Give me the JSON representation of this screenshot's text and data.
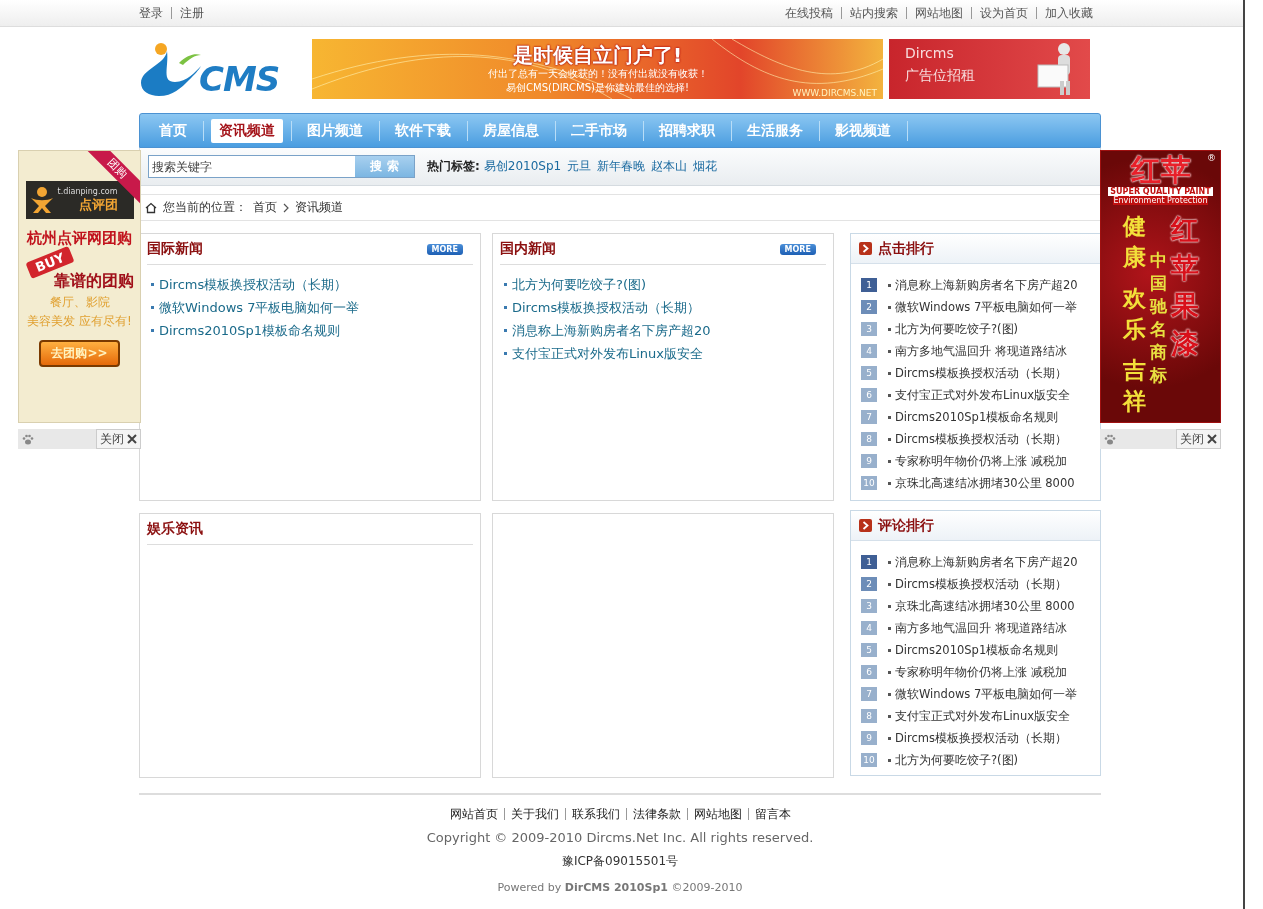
{
  "top_bar": {
    "left_links": [
      "登录",
      "注册"
    ],
    "right_links": [
      "在线投稿",
      "站内搜索",
      "网站地图",
      "设为首页",
      "加入收藏"
    ]
  },
  "header": {
    "logo": "CMS",
    "banner": {
      "title": "是时候自立门户了!",
      "lines": [
        "付出了总有一天会收获的！没有付出就没有收获！",
        "易创CMS(DIRCMS)是你建站最佳的选择!"
      ],
      "url": "WWW.DIRCMS.NET"
    },
    "side_ad": {
      "brand": "Dircms",
      "text": "广告位招租"
    }
  },
  "nav": [
    {
      "label": "首页",
      "selected": false
    },
    {
      "label": "资讯频道",
      "selected": true
    },
    {
      "label": "图片频道",
      "selected": false
    },
    {
      "label": "软件下载",
      "selected": false
    },
    {
      "label": "房屋信息",
      "selected": false
    },
    {
      "label": "二手市场",
      "selected": false
    },
    {
      "label": "招聘求职",
      "selected": false
    },
    {
      "label": "生活服务",
      "selected": false
    },
    {
      "label": "影视频道",
      "selected": false
    }
  ],
  "search": {
    "placeholder": "搜索关键字",
    "button": "搜 索"
  },
  "hot_tags": {
    "label": "热门标签:",
    "tags": [
      "易创2010Sp1",
      "元旦",
      "新年春晚",
      "赵本山",
      "烟花"
    ]
  },
  "breadcrumb": {
    "label": "您当前的位置：",
    "items": [
      "首页",
      "资讯频道"
    ]
  },
  "news_panels": [
    {
      "title": "国际新闻",
      "more": "MORE",
      "items": [
        "Dircms模板换授权活动（长期）",
        "微软Windows 7平板电脑如何一举",
        "Dircms2010Sp1模板命名规则"
      ]
    },
    {
      "title": "国内新闻",
      "more": "MORE",
      "items": [
        "北方为何要吃饺子?(图)",
        "Dircms模板换授权活动（长期）",
        "消息称上海新购房者名下房产超20",
        "支付宝正式对外发布Linux版安全"
      ]
    },
    {
      "title": "娱乐资讯"
    }
  ],
  "rankings": [
    {
      "title": "点击排行",
      "items": [
        {
          "rank": "1",
          "text": "消息称上海新购房者名下房产超20"
        },
        {
          "rank": "2",
          "text": "微软Windows 7平板电脑如何一举"
        },
        {
          "rank": "3",
          "text": "北方为何要吃饺子?(图)"
        },
        {
          "rank": "4",
          "text": "南方多地气温回升 将现道路结冰"
        },
        {
          "rank": "5",
          "text": "Dircms模板换授权活动（长期）"
        },
        {
          "rank": "6",
          "text": "支付宝正式对外发布Linux版安全"
        },
        {
          "rank": "7",
          "text": "Dircms2010Sp1模板命名规则"
        },
        {
          "rank": "8",
          "text": "Dircms模板换授权活动（长期）"
        },
        {
          "rank": "9",
          "text": "专家称明年物价仍将上涨 减税加"
        },
        {
          "rank": "10",
          "text": "京珠北高速结冰拥堵30公里 8000"
        }
      ]
    },
    {
      "title": "评论排行",
      "items": [
        {
          "rank": "1",
          "text": "消息称上海新购房者名下房产超20"
        },
        {
          "rank": "2",
          "text": "Dircms模板换授权活动（长期）"
        },
        {
          "rank": "3",
          "text": "京珠北高速结冰拥堵30公里 8000"
        },
        {
          "rank": "4",
          "text": "南方多地气温回升 将现道路结冰"
        },
        {
          "rank": "5",
          "text": "Dircms2010Sp1模板命名规则"
        },
        {
          "rank": "6",
          "text": "专家称明年物价仍将上涨 减税加"
        },
        {
          "rank": "7",
          "text": "微软Windows 7平板电脑如何一举"
        },
        {
          "rank": "8",
          "text": "支付宝正式对外发布Linux版安全"
        },
        {
          "rank": "9",
          "text": "Dircms模板换授权活动（长期）"
        },
        {
          "rank": "10",
          "text": "北方为何要吃饺子?(图)"
        }
      ]
    }
  ],
  "footer": {
    "links": [
      "网站首页",
      "关于我们",
      "联系我们",
      "法律条款",
      "网站地图",
      "留言本"
    ],
    "copyright": "Copyright © 2009-2010 Dircms.Net Inc. All rights reserved.",
    "icp": "豫ICP备09015501号",
    "powered": "Powered by **DirCMS 2010Sp1** ©2009-2010"
  },
  "floating_ads": [
    {
      "kind": "tuangou",
      "ribbon": "团购",
      "site": "t.dianping.com",
      "brand": "点评团",
      "headline": "杭州点评网团购",
      "tag": "BUY",
      "slogan": "靠谱的团购",
      "lines": [
        "餐厅、影院",
        "美容美发 应有尽有!"
      ],
      "button": "去团购>>",
      "close": "关闭"
    },
    {
      "kind": "paint",
      "brand": "红苹",
      "mark": "®",
      "tagline": "SUPER QUALITY PAINT",
      "sub": "Environment Protection",
      "left": [
        "健康",
        "欢乐",
        "吉祥"
      ],
      "middle": "中国驰名商标",
      "right": "红苹果漆",
      "close": "关闭"
    }
  ]
}
